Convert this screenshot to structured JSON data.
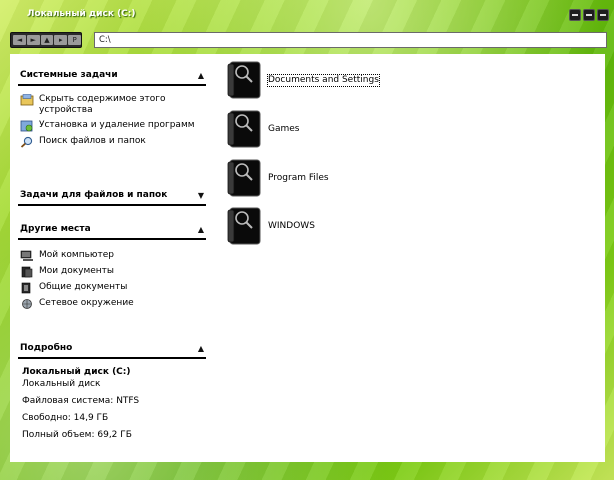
{
  "window": {
    "title": "Локальный диск (C:)"
  },
  "address": {
    "path": "C:\\"
  },
  "nav": {
    "back": "◄",
    "forward": "►",
    "up": "▲",
    "go": "▸",
    "views": "P"
  },
  "panels": {
    "system_tasks": {
      "title": "Системные задачи",
      "items": [
        {
          "label": "Скрыть содержимое этого устройства",
          "icon": "hide-contents-icon"
        },
        {
          "label": "Установка и удаление программ",
          "icon": "add-remove-programs-icon"
        },
        {
          "label": "Поиск файлов и папок",
          "icon": "search-icon"
        }
      ]
    },
    "file_tasks": {
      "title": "Задачи для файлов и папок"
    },
    "other_places": {
      "title": "Другие места",
      "items": [
        {
          "label": "Мой компьютер",
          "icon": "my-computer-icon"
        },
        {
          "label": "Мои документы",
          "icon": "my-documents-icon"
        },
        {
          "label": "Общие документы",
          "icon": "shared-documents-icon"
        },
        {
          "label": "Сетевое окружение",
          "icon": "network-places-icon"
        }
      ]
    },
    "details": {
      "title": "Подробно",
      "name": "Локальный диск (C:)",
      "type": "Локальный диск",
      "filesystem": "Файловая система: NTFS",
      "free": "Свободно: 14,9 ГБ",
      "total": "Полный объем: 69,2 ГБ"
    }
  },
  "folders": [
    {
      "name": "Documents and Settings",
      "selected": true
    },
    {
      "name": "Games"
    },
    {
      "name": "Program Files"
    },
    {
      "name": "WINDOWS"
    }
  ],
  "colors": {
    "accent": "#6cc012",
    "frame_light": "#d4ef6a"
  }
}
